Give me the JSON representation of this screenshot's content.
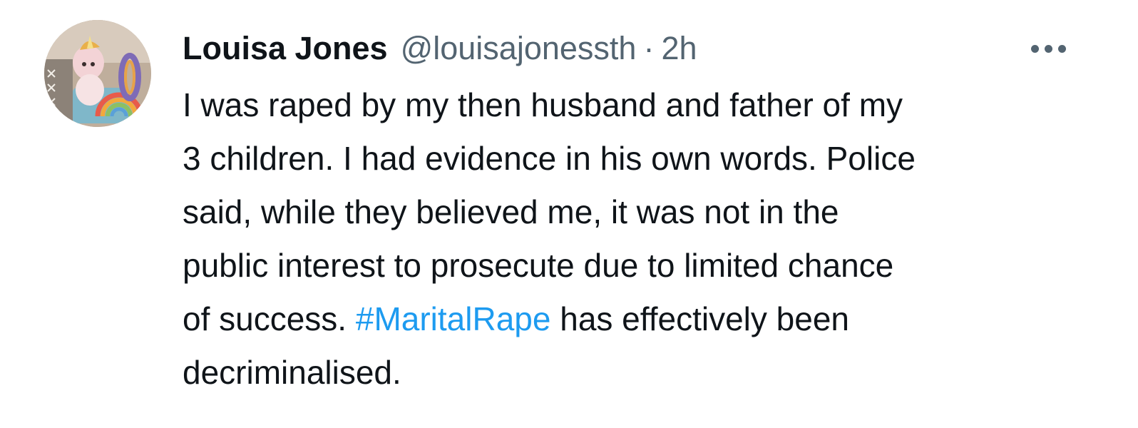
{
  "tweet": {
    "author": {
      "display_name": "Louisa Jones",
      "handle": "@louisajonessth",
      "avatar_icon": "avatar-image"
    },
    "separator": "·",
    "timestamp": "2h",
    "more_icon": "more-options-icon",
    "text_lines": {
      "line1": "I was raped by my then husband and father of my",
      "line2": "3 children. I had evidence in his own words. Police",
      "line3": "said, while they believed me, it was not in the",
      "line4": "public interest to prosecute due to limited chance",
      "line5_before": "of success. ",
      "line5_hashtag": "#MaritalRape",
      "line5_after": " has effectively been",
      "line6": "decriminalised."
    }
  },
  "colors": {
    "text_primary": "#0f1419",
    "text_secondary": "#536471",
    "link": "#1d9bf0",
    "background": "#ffffff"
  }
}
